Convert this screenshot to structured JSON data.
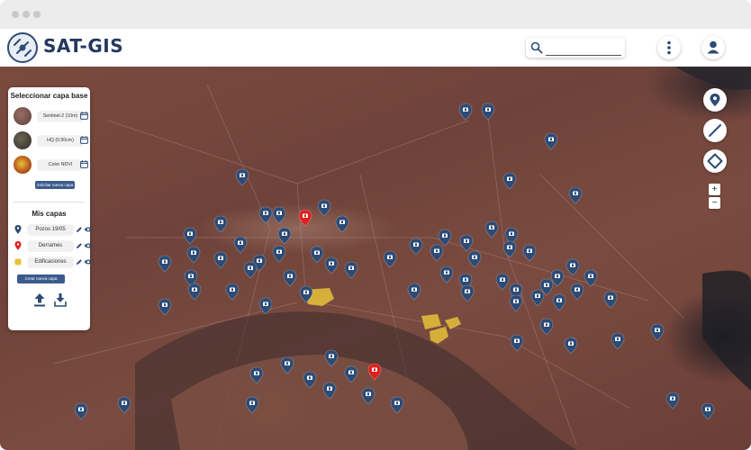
{
  "app": {
    "title": "SAT-GIS"
  },
  "colors": {
    "pin_blue": "#2d4b75",
    "pin_red": "#e02020",
    "brand": "#22385e",
    "polygon": "#e7c13a"
  },
  "icons": {
    "search": "search-icon",
    "menu": "more-vertical-icon",
    "user": "user-icon",
    "pin_tool": "location-pin-icon",
    "line_tool": "line-draw-icon",
    "polygon_tool": "polygon-draw-icon"
  },
  "search": {
    "value": "",
    "placeholder": ""
  },
  "panel": {
    "base_title": "Seleccionar capa base",
    "base_layers": [
      {
        "label": "Sentinel-2 (10m)",
        "thumb": "#7a5a54"
      },
      {
        "label": "HQ (0.50cm)",
        "thumb": "#4e4a40"
      },
      {
        "label": "Color NDVI",
        "thumb": "#b8681e"
      }
    ],
    "select_button": "Solicitar nueva capa",
    "my_title": "Mis capas",
    "my_layers": [
      {
        "label": "Pozos 19/05",
        "color": "#2d4b75"
      },
      {
        "label": "Derrames",
        "color": "#e02020"
      },
      {
        "label": "Edificaciones",
        "color": "#e7c13a"
      }
    ],
    "create_button": "Crear nueva capa"
  },
  "zoom": {
    "in": "+",
    "out": "−"
  }
}
